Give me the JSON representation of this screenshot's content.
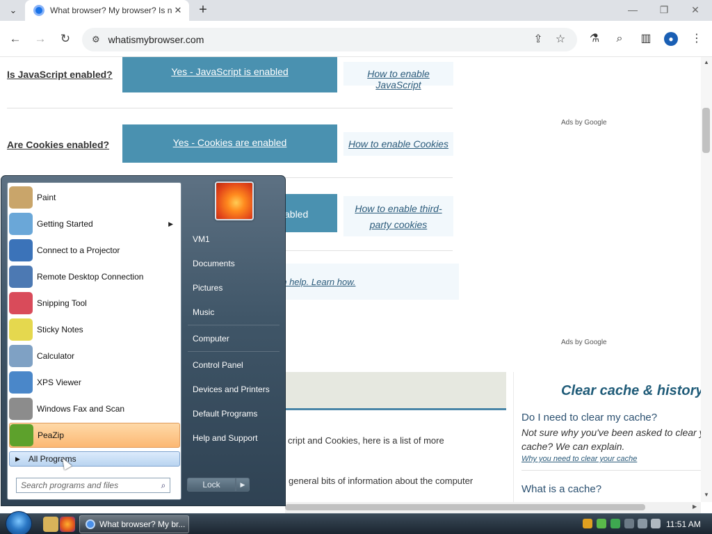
{
  "browser": {
    "tab_title": "What browser? My browser? Is n",
    "url": "whatismybrowser.com"
  },
  "page": {
    "rows": [
      {
        "question": "Is JavaScript enabled?",
        "answer": "Yes - JavaScript is enabled",
        "howto": "How to enable JavaScript"
      },
      {
        "question": "Are Cookies enabled?",
        "answer": "Yes - Cookies are enabled",
        "howto": "How to enable Cookies"
      },
      {
        "answer_partial": "abled",
        "howto_line1": "How to enable third-",
        "howto_line2": "party cookies"
      }
    ],
    "learn_partial": "an help. Learn how.",
    "ads_label": "Ads by Google",
    "body_line1": "cript and Cookies, here is a list of more",
    "body_line2": "general bits of information about the computer",
    "sidebar": {
      "title": "Clear cache & history",
      "q1": "Do I need to clear my cache?",
      "a1_line1": "Not sure why you've been asked to clear y",
      "a1_line2": "cache? We can explain.",
      "link1": "Why you need to clear your cache",
      "q2": "What is a cache?"
    }
  },
  "start_menu": {
    "programs": [
      {
        "label": "Paint",
        "color": "#c9a56a"
      },
      {
        "label": "Getting Started",
        "color": "#6aa7d8",
        "has_arrow": true
      },
      {
        "label": "Connect to a Projector",
        "color": "#3b73b9"
      },
      {
        "label": "Remote Desktop Connection",
        "color": "#4c79b3"
      },
      {
        "label": "Snipping Tool",
        "color": "#d94b5a"
      },
      {
        "label": "Sticky Notes",
        "color": "#e5d84e"
      },
      {
        "label": "Calculator",
        "color": "#7fa1c4"
      },
      {
        "label": "XPS Viewer",
        "color": "#4a87c9"
      },
      {
        "label": "Windows Fax and Scan",
        "color": "#8c8c8c"
      },
      {
        "label": "PeaZip",
        "color": "#5da12c"
      }
    ],
    "all_programs": "All Programs",
    "search_placeholder": "Search programs and files",
    "right_items": [
      "VM1",
      "Documents",
      "Pictures",
      "Music",
      "Computer",
      "Control Panel",
      "Devices and Printers",
      "Default Programs",
      "Help and Support"
    ],
    "lock_label": "Lock"
  },
  "taskbar": {
    "task_title": "What browser? My br...",
    "time": "11:51 AM"
  }
}
